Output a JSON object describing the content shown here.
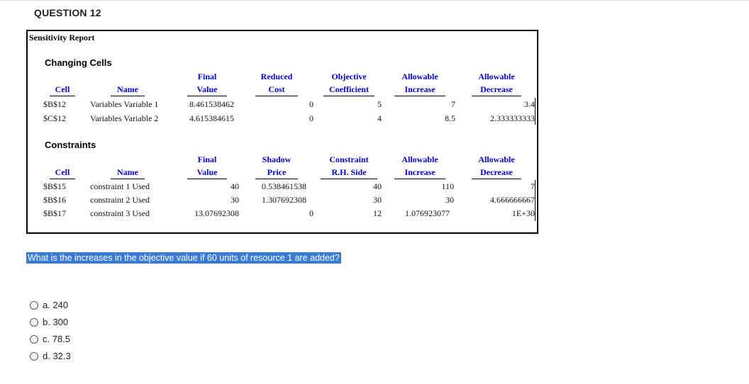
{
  "question_title": "QUESTION 12",
  "report": {
    "title": "Sensitivity Report",
    "changing": {
      "section_title": "Changing Cells",
      "headers": {
        "cell": "Cell",
        "name": "Name",
        "final_1": "Final",
        "final_2": "Value",
        "reduced_1": "Reduced",
        "reduced_2": "Cost",
        "objective_1": "Objective",
        "objective_2": "Coefficient",
        "allow_inc_1": "Allowable",
        "allow_inc_2": "Increase",
        "allow_dec_1": "Allowable",
        "allow_dec_2": "Decrease"
      },
      "rows": [
        {
          "cell": "$B$12",
          "name": "Variables Variable 1",
          "final": "8.461538462",
          "reduced": "0",
          "objective": "5",
          "inc": "7",
          "dec": "3.4"
        },
        {
          "cell": "$C$12",
          "name": "Variables Variable 2",
          "final": "4.615384615",
          "reduced": "0",
          "objective": "4",
          "inc": "8.5",
          "dec": "2.333333333"
        }
      ]
    },
    "constraints": {
      "section_title": "Constraints",
      "headers": {
        "cell": "Cell",
        "name": "Name",
        "final_1": "Final",
        "final_2": "Value",
        "shadow_1": "Shadow",
        "shadow_2": "Price",
        "rhs_1": "Constraint",
        "rhs_2": "R.H. Side",
        "allow_inc_1": "Allowable",
        "allow_inc_2": "Increase",
        "allow_dec_1": "Allowable",
        "allow_dec_2": "Decrease"
      },
      "rows": [
        {
          "cell": "$B$15",
          "name": "constraint 1 Used",
          "final": "40",
          "shadow": "0.538461538",
          "rhs": "40",
          "inc": "110",
          "dec": "7"
        },
        {
          "cell": "$B$16",
          "name": "constraint 2 Used",
          "final": "30",
          "shadow": "1.307692308",
          "rhs": "30",
          "inc": "30",
          "dec": "4.666666667"
        },
        {
          "cell": "$B$17",
          "name": "constraint 3 Used",
          "final": "13.07692308",
          "shadow": "0",
          "rhs": "12",
          "inc": "1.076923077",
          "dec": "1E+30"
        }
      ]
    }
  },
  "question_text": "What is the increases in the objective value if 60 units of resource 1 are added?",
  "options": [
    {
      "label": "a. 240"
    },
    {
      "label": "b. 300"
    },
    {
      "label": "c. 78.5"
    },
    {
      "label": "d. 32.3"
    }
  ],
  "colors": {
    "header_blue": "#0000cc",
    "highlight": "#3a7bd5"
  }
}
